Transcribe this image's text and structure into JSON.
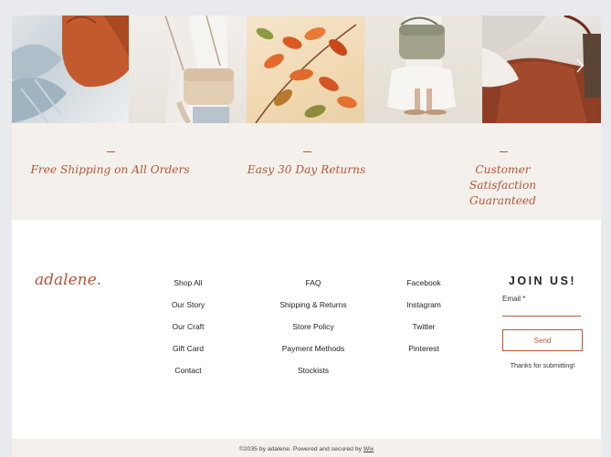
{
  "gallery": {
    "items": [
      {
        "name": "Orange leather tote on knit sweater"
      },
      {
        "name": "Person carrying beige crossbody bag"
      },
      {
        "name": "Autumn orange leaves"
      },
      {
        "name": "Sage green shoulder bag with sandals"
      },
      {
        "name": "Brown leather bag with hat"
      }
    ],
    "next_icon": "chevron-right-icon"
  },
  "promo": {
    "items": [
      {
        "text": "Free Shipping on All Orders"
      },
      {
        "text": "Easy 30 Day Returns"
      },
      {
        "text": "Customer Satisfaction Guaranteed"
      }
    ]
  },
  "footer": {
    "logo": "adalene.",
    "col1": [
      "Shop All",
      "Our Story",
      "Our Craft",
      "Gift Card",
      "Contact"
    ],
    "col2": [
      "FAQ",
      "Shipping & Returns",
      "Store Policy",
      "Payment Methods",
      "Stockists"
    ],
    "col3": [
      "Facebook",
      "Instagram",
      "Twitter",
      "Pinterest"
    ],
    "join": {
      "title": "JOIN US!",
      "email_label": "Email *",
      "email_value": "",
      "send_label": "Send",
      "thanks": "Thanks for submitting!"
    },
    "copyright": "©2035 by adalene. Powered and secured by",
    "wix": "Wix"
  },
  "colors": {
    "accent": "#b5553a",
    "band": "#f4f1ec"
  }
}
